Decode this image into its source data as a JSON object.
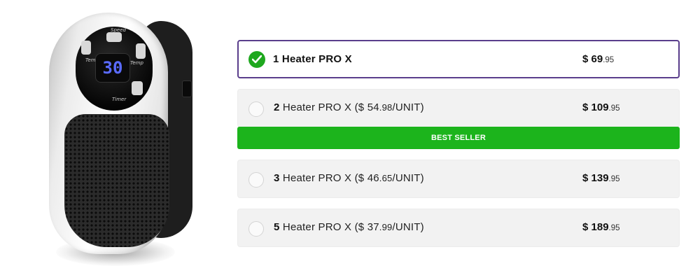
{
  "product": {
    "image_alt": "portable plug-in heater",
    "display_value": "30",
    "panel_labels": [
      "Speed",
      "Temp",
      "Temp",
      "Timer"
    ]
  },
  "options": [
    {
      "qty": "1",
      "name": "Heater PRO X",
      "unit_prefix": "",
      "unit_main": "",
      "unit_cents": "",
      "unit_suffix": "",
      "price_main": "$ 69",
      "price_cents": ".95",
      "selected": true
    },
    {
      "qty": "2",
      "name": "Heater PRO X",
      "unit_prefix": "($ ",
      "unit_main": "54",
      "unit_cents": ".98",
      "unit_suffix": "/UNIT)",
      "price_main": "$ 109",
      "price_cents": ".95",
      "selected": false
    },
    {
      "qty": "3",
      "name": "Heater PRO X",
      "unit_prefix": "($ ",
      "unit_main": "46",
      "unit_cents": ".65",
      "unit_suffix": "/UNIT)",
      "price_main": "$ 139",
      "price_cents": ".95",
      "selected": false
    },
    {
      "qty": "5",
      "name": "Heater PRO X",
      "unit_prefix": "($ ",
      "unit_main": "37",
      "unit_cents": ".99",
      "unit_suffix": "/UNIT)",
      "price_main": "$ 189",
      "price_cents": ".95",
      "selected": false
    }
  ],
  "badge": {
    "label": "BEST SELLER"
  },
  "colors": {
    "selected_border": "#5a3e8c",
    "check": "#1fa81f",
    "badge": "#1cb41c",
    "option_bg": "#f2f2f2"
  }
}
